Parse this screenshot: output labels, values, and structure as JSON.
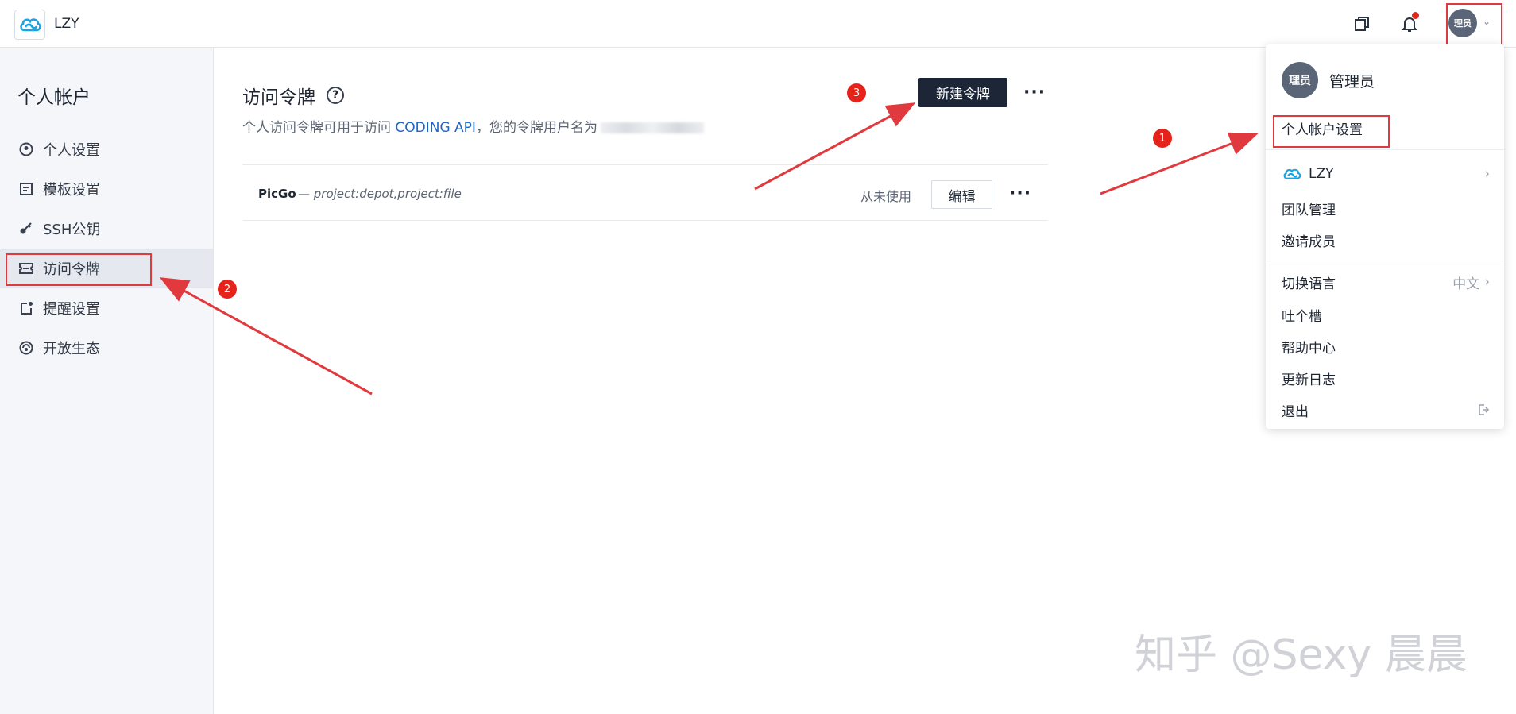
{
  "topbar": {
    "team_name": "LZY",
    "avatar_text": "理员"
  },
  "sidebar": {
    "title": "个人帐户",
    "items": [
      {
        "label": "个人设置",
        "icon": "user-circle-icon"
      },
      {
        "label": "模板设置",
        "icon": "template-icon"
      },
      {
        "label": "SSH公钥",
        "icon": "key-icon"
      },
      {
        "label": "访问令牌",
        "icon": "ticket-icon"
      },
      {
        "label": "提醒设置",
        "icon": "reminder-icon"
      },
      {
        "label": "开放生态",
        "icon": "ecosystem-icon"
      }
    ]
  },
  "main": {
    "title": "访问令牌",
    "subtitle_prefix": "个人访问令牌可用于访问 ",
    "subtitle_link": "CODING API",
    "subtitle_suffix": "，您的令牌用户名为",
    "new_token_label": "新建令牌",
    "token": {
      "name": "PicGo",
      "scope": "— project:depot,project:file",
      "status": "从未使用",
      "edit_label": "编辑"
    }
  },
  "dropdown": {
    "avatar_text": "理员",
    "username": "管理员",
    "account_settings": "个人帐户设置",
    "team": "LZY",
    "team_manage": "团队管理",
    "invite": "邀请成员",
    "switch_language": "切换语言",
    "language_value": "中文",
    "feedback": "吐个槽",
    "help": "帮助中心",
    "changelog": "更新日志",
    "logout": "退出"
  },
  "annotations": {
    "badge1": "1",
    "badge2": "2",
    "badge3": "3",
    "color": "#e0393e"
  },
  "watermark": "知乎 @Sexy 晨晨"
}
